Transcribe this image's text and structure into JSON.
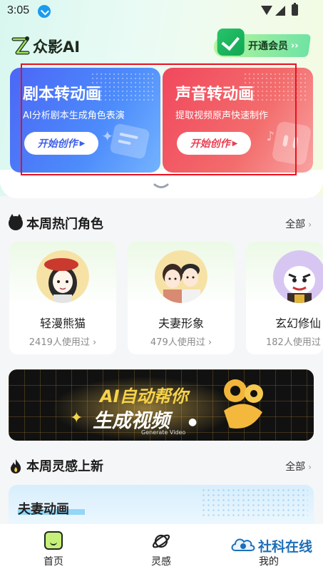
{
  "status_bar": {
    "time": "3:05",
    "download_icon": "download-icon",
    "wifi_icon": "wifi-icon",
    "signal_icon": "signal-icon",
    "battery_icon": "battery-icon"
  },
  "header": {
    "app_name": "众影AI",
    "logo_icon": "z-logo-icon",
    "vip_label": "开通会员",
    "vip_arrows": "››",
    "vip_icon": "check-badge-icon"
  },
  "feature_cards": [
    {
      "title": "剧本转动画",
      "subtitle": "AI分析剧本生成角色表演",
      "button": "开始创作",
      "color": "#4b67f6"
    },
    {
      "title": "声音转动画",
      "subtitle": "提取视频原声快速制作",
      "button": "开始创作",
      "color": "#f1485d"
    }
  ],
  "hot_section": {
    "title": "本周热门角色",
    "more": "全部",
    "icon": "cat-icon"
  },
  "characters": [
    {
      "name": "轻漫熊猫",
      "count": "2419人使用过"
    },
    {
      "name": "夫妻形象",
      "count": "479人使用过"
    },
    {
      "name": "玄幻修仙",
      "count": "182人使用过"
    }
  ],
  "banner": {
    "line1": "AI自动帮你",
    "line2": "生成视频",
    "sub": "Generate Video"
  },
  "inspiration_section": {
    "title": "本周灵感上新",
    "more": "全部",
    "icon": "fire-icon"
  },
  "inspiration_card": {
    "title": "夫妻动画"
  },
  "bottom_nav": [
    {
      "label": "首页",
      "icon": "home-icon",
      "active": true
    },
    {
      "label": "灵感",
      "icon": "planet-icon",
      "active": false
    },
    {
      "label": "我的",
      "icon": "profile-icon",
      "active": false
    }
  ],
  "watermark": {
    "text": "社科在线"
  },
  "colors": {
    "accent_green": "#12a653",
    "highlight_red": "#e8101e",
    "blue_card": "#4b67f6",
    "red_card": "#f1485d"
  }
}
